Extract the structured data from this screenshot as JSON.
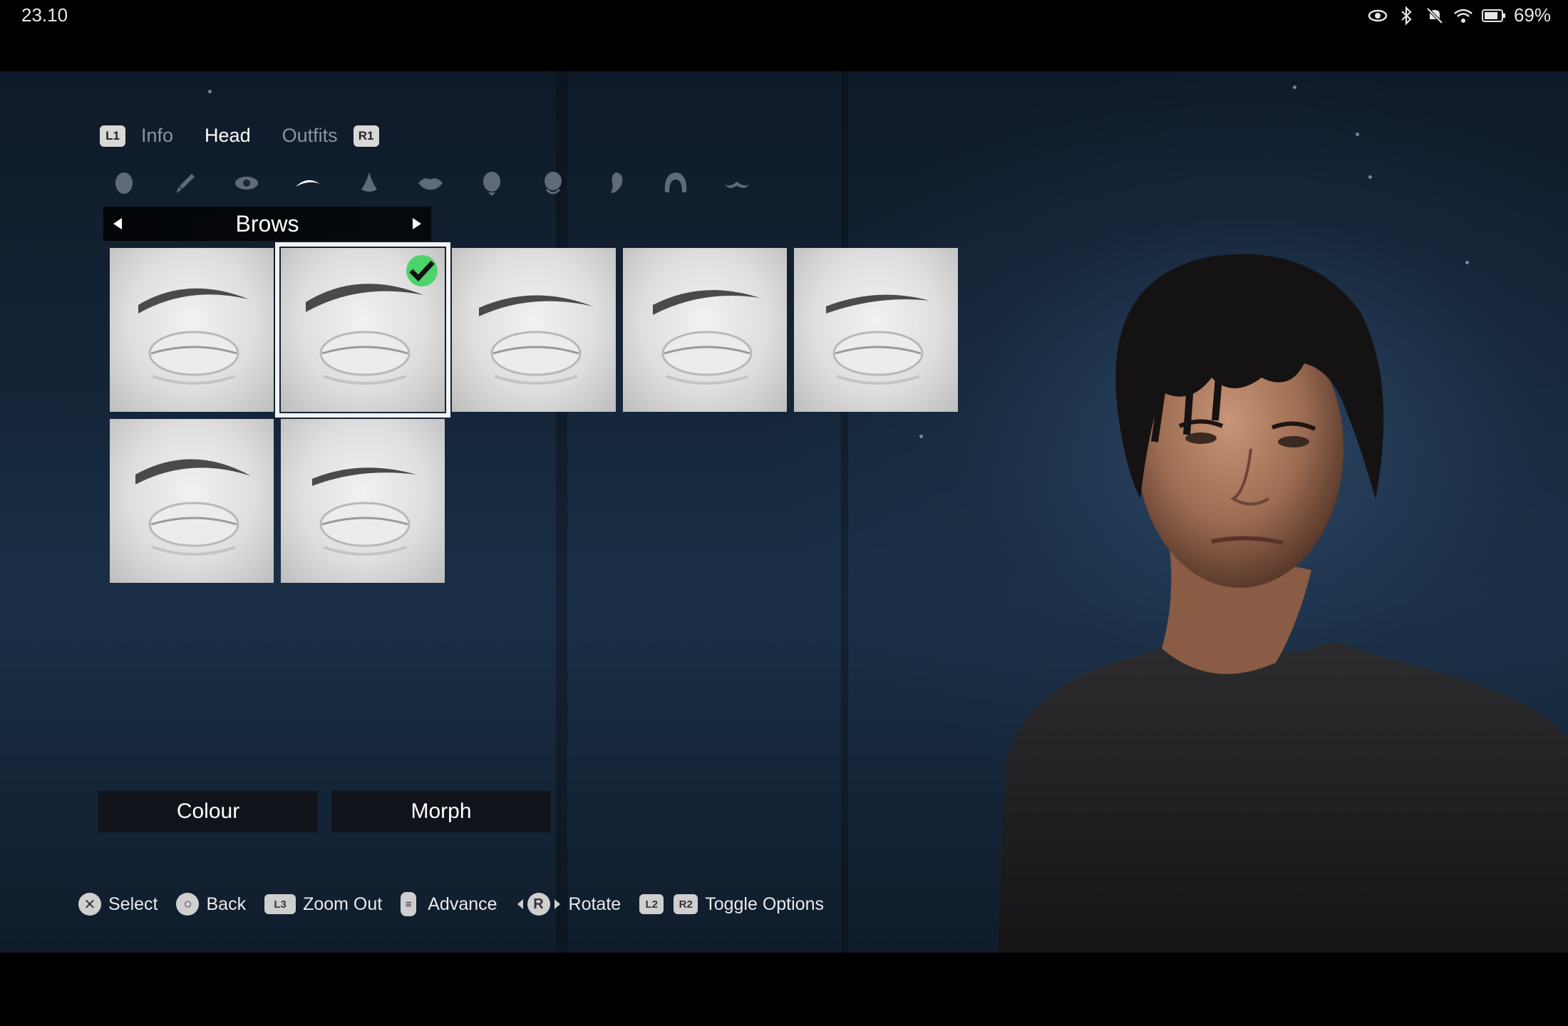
{
  "status_bar": {
    "time": "23.10",
    "battery": "69%",
    "icons": [
      "eye-icon",
      "bluetooth-icon",
      "mute-icon",
      "wifi-icon",
      "battery-icon"
    ]
  },
  "tabs": {
    "left_button": "L1",
    "right_button": "R1",
    "items": [
      {
        "label": "Info",
        "active": false
      },
      {
        "label": "Head",
        "active": true
      },
      {
        "label": "Outfits",
        "active": false
      }
    ]
  },
  "categories": [
    "head-shape-icon",
    "brush-icon",
    "eye-icon",
    "brow-icon",
    "nose-icon",
    "lips-icon",
    "cheek-icon",
    "jaw-icon",
    "ear-icon",
    "hair-icon",
    "moustache-icon"
  ],
  "active_category": "brow-icon",
  "selector": {
    "label": "Brows"
  },
  "brow_options": {
    "count": 7,
    "selected_index": 1
  },
  "options": {
    "colour": "Colour",
    "morph": "Morph"
  },
  "hints": [
    {
      "button": "✕",
      "label": "Select"
    },
    {
      "button": "○",
      "label": "Back"
    },
    {
      "button": "L3",
      "label": "Zoom Out"
    },
    {
      "button": "≡",
      "label": "Advance"
    },
    {
      "button": "R",
      "label": "Rotate"
    },
    {
      "button_a": "L2",
      "button_b": "R2",
      "label": "Toggle Options"
    }
  ],
  "colors": {
    "selected_check": "#4cd36a",
    "active_tab": "#ffffff",
    "inactive_tab": "#8a95a3"
  }
}
